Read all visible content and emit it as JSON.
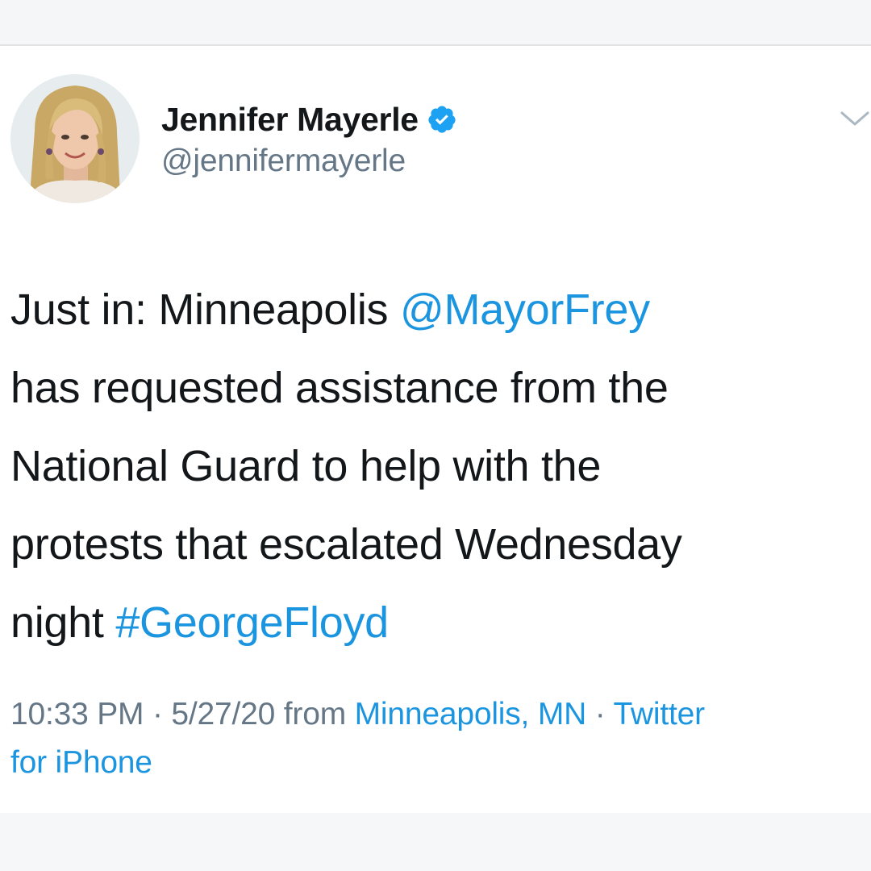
{
  "tweet": {
    "author": {
      "display_name": "Jennifer Mayerle",
      "handle": "@jennifermayerle",
      "verified": true
    },
    "text_lines": [
      {
        "text": "Just in: Minneapolis ",
        "mention": "@MayorFrey",
        "after": ""
      },
      {
        "text": "has requested assistance from the"
      },
      {
        "text": "National Guard to help with the"
      },
      {
        "text": "protests that escalated Wednesday"
      },
      {
        "text": "night ",
        "hashtag": "#GeorgeFloyd"
      }
    ],
    "meta": {
      "time": "10:33 PM",
      "separator": " · ",
      "date": "5/27/20",
      "from_label": " from ",
      "location": "Minneapolis, MN",
      "source_line1": "Twitter",
      "source_line2": "for iPhone"
    }
  },
  "icons": {
    "verified": "verified-badge-icon",
    "menu": "chevron-down-icon",
    "avatar": "profile-photo"
  },
  "colors": {
    "link": "#1b95e0",
    "secondary_text": "#657786",
    "primary_text": "#14171a",
    "verified_badge": "#1da1f2"
  }
}
